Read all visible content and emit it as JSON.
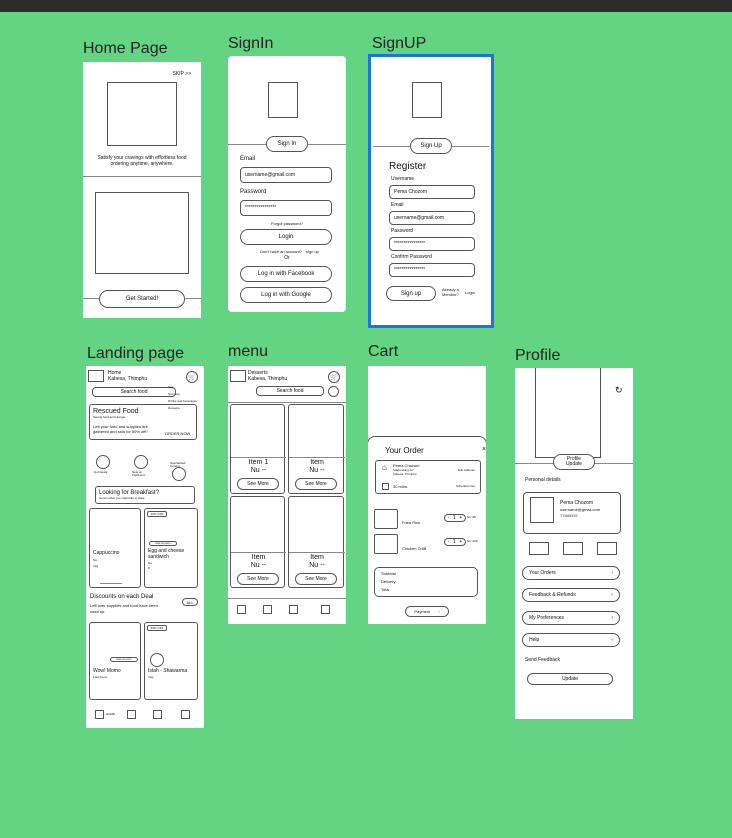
{
  "frames": {
    "home": {
      "title": "Home Page",
      "skip": "SKIP >>",
      "tagline_1": "Satisfy your cravings with effortless food",
      "tagline_2": "ordering anytime, anywhere.",
      "cta": "Get Started!"
    },
    "signin": {
      "title": "SignIn",
      "tab": "Sign In",
      "email_label": "Email",
      "email_value": "username@gmail.com",
      "password_label": "Password",
      "password_value": "****************",
      "forgot": "Forgot password?",
      "login": "Login",
      "no_account": "Don't have an account?",
      "signup_link": "sign up",
      "or": "Or",
      "facebook": "Log in with Facebook",
      "google": "Log in with Google"
    },
    "signup": {
      "title": "SignUP",
      "tab": "Sign Up",
      "heading": "Register",
      "username_label": "Username",
      "username_value": "Pema Chozom",
      "email_label": "Email",
      "email_value": "username@gmail.com",
      "password_label": "Password",
      "password_value": "****************",
      "confirm_label": "Confirm Password",
      "confirm_value": "****************",
      "signup_btn": "Sign up",
      "already_1": "Already a",
      "already_2": "Member?",
      "login_link": "Login"
    },
    "landing": {
      "title": "Landing page",
      "loc_1": "Home",
      "loc_2": "Kabesa, Thimphu",
      "search": "Search food",
      "menu_items": [
        "Veg",
        "Non Veg",
        "Drinks and beverages",
        "Desserts"
      ],
      "rescued_title": "Rescued Food",
      "rescued_sub": "Saving food and Hunger,",
      "rescued_desc_1": "Left your food and supplies are",
      "rescued_desc_2": "gathered and sold for 50% off!!",
      "order_now": "ORDER NOW",
      "categories": [
        "Hot Deals",
        "New on FastFood",
        "Specialized Cuisine"
      ],
      "breakfast_title": "Looking for Breakfast?",
      "breakfast_sub": "Here's what you might like to taste",
      "badge_off": "20% OFF",
      "free_delivery": "FREE DELIVERY",
      "item1_name": "Cappuccino",
      "item1_a": "Nu",
      "item1_b": "Veg",
      "item2_name_1": "Egg and cheese",
      "item2_name_2": "sandwich",
      "item2_a": "Nu",
      "item2_b": "8",
      "discounts_title": "Discounts on each Deal",
      "discounts_desc_1": "Left over supplies and food have been",
      "discounts_desc_2": "used up.",
      "all": "ALL",
      "badge_off2": "50% OFF",
      "item3_name": "Wow! Momo",
      "item3_sub": "Fast Food",
      "item4_name": "Istah - Shawarma",
      "item4_sub": "Veg",
      "nav_home": "HOME"
    },
    "menu": {
      "title": "menu",
      "loc_1": "Desserts",
      "loc_2": "Kabesa, Thimphu",
      "search": "Search food",
      "items": [
        {
          "name": "Item 1",
          "price": "Nu --",
          "btn": "See More"
        },
        {
          "name": "Item",
          "price": "Nu --",
          "btn": "See More"
        },
        {
          "name": "Item",
          "price": "Nu --",
          "btn": "See More"
        },
        {
          "name": "Item",
          "price": "Nu --",
          "btn": "See More"
        }
      ]
    },
    "cart": {
      "title": "Cart",
      "heading": "Your Order",
      "close": "×",
      "addr_name": "Pema Chozom",
      "addr_line1": "Starbucking G7,",
      "addr_line2": "Kabesa, Thimphu",
      "edit": "Edit Address",
      "time": "30 mins",
      "schedule": "Schedule time",
      "line_items": [
        {
          "name": "Fried Rice",
          "qty": "1",
          "price": "Nu. 80"
        },
        {
          "name": "Chicken Chilli",
          "qty": "1",
          "price": "Nu. 200"
        }
      ],
      "subtotal": "Subtotal",
      "delivery": "Delivery",
      "total": "Total",
      "payment": "Payment"
    },
    "profile": {
      "title": "Profile",
      "update_btn_1": "Profile",
      "update_btn_2": "Update",
      "personal": "Personal details",
      "name": "Pema Chozom",
      "email": "username@gmail.com",
      "phone": "77443137",
      "menu": [
        "Your Orders",
        "Feedback & Refunds",
        "My Preferences",
        "Help"
      ],
      "send_feedback": "Send Feedback",
      "update": "Update"
    }
  }
}
